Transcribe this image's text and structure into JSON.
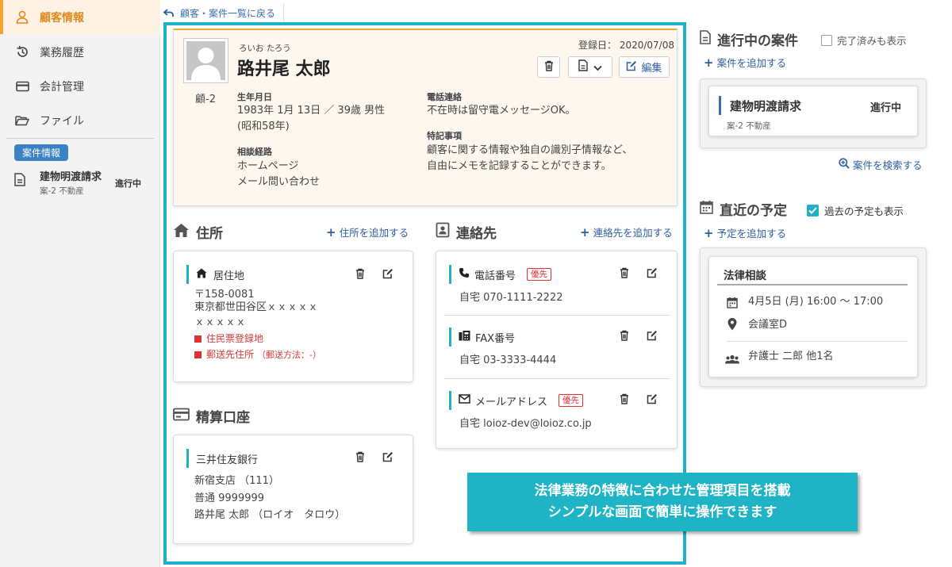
{
  "sidebar": {
    "items": [
      {
        "label": "顧客情報",
        "icon": "person-icon"
      },
      {
        "label": "業務履歴",
        "icon": "history-icon"
      },
      {
        "label": "会計管理",
        "icon": "card-icon"
      },
      {
        "label": "ファイル",
        "icon": "folder-icon"
      }
    ],
    "case_section_label": "案件情報",
    "case": {
      "title": "建物明渡請求",
      "sub": "案-2 不動産",
      "status": "進行中"
    }
  },
  "back_link": "顧客・案件一覧に戻る",
  "profile": {
    "reg_date": "登録日： 2020/07/08",
    "furigana": "ろいお たろう",
    "name": "路井尾 太郎",
    "id": "顧-2",
    "edit_label": "編集",
    "birth_label": "生年月日",
    "birth_line1": "1983年 1月 13日 ／ 39歳 男性",
    "birth_line2": "(昭和58年)",
    "route_label": "相談経路",
    "route_line1": "ホームページ",
    "route_line2": "メール問い合わせ",
    "tel_label": "電話連絡",
    "tel_value": "不在時は留守電メッセージOK。",
    "note_label": "特記事項",
    "note_line1": "顧客に関する情報や独自の識別子情報など、",
    "note_line2": "自由にメモを記録することができます。"
  },
  "address": {
    "title": "住所",
    "add": "住所を追加する",
    "card_label": "居住地",
    "postal": "〒158-0081",
    "line1": "東京都世田谷区ｘｘｘｘｘ",
    "line2": "ｘｘｘｘｘ",
    "tag1": "住民票登録地",
    "tag2": "郵送先住所",
    "tag2_note": "（郵送方法：-）"
  },
  "bank": {
    "title": "精算口座",
    "bank_name": "三井住友銀行",
    "branch": "新宿支店 （111）",
    "account": "普通 9999999",
    "holder": "路井尾 太郎 （ロイオ　タロウ）"
  },
  "contacts": {
    "title": "連絡先",
    "add": "連絡先を追加する",
    "priority": "優先",
    "items": [
      {
        "label": "電話番号",
        "value": "自宅 070-1111-2222"
      },
      {
        "label": "FAX番号",
        "value": "自宅 03-3333-4444"
      },
      {
        "label": "メールアドレス",
        "value": "自宅 loioz-dev@loioz.co.jp"
      }
    ]
  },
  "cases": {
    "title": "進行中の案件",
    "show_done": "完了済みも表示",
    "add": "案件を追加する",
    "card_title": "建物明渡請求",
    "card_sub": "案-2 不動産",
    "card_status": "進行中",
    "search": "案件を検索する"
  },
  "schedule": {
    "title": "直近の予定",
    "show_past": "過去の予定も表示",
    "add": "予定を追加する",
    "card_title": "法律相談",
    "datetime": "4月5日 (月) 16:00 〜 17:00",
    "place": "会議室D",
    "members": "弁護士 二郎 他1名"
  },
  "callout": {
    "line1": "法律業務の特徴に合わせた管理項目を搭載",
    "line2": "シンプルな画面で簡単に操作できます"
  }
}
